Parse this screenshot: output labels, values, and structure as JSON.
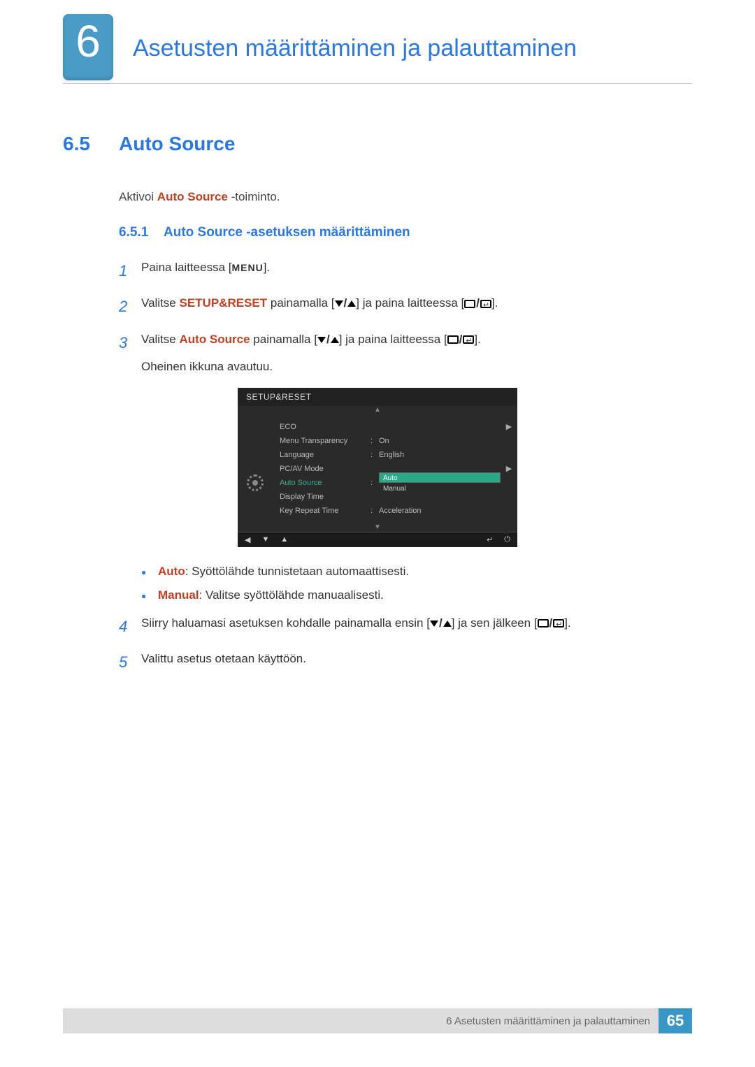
{
  "chapter": {
    "number": "6",
    "title": "Asetusten määrittäminen ja palauttaminen"
  },
  "section": {
    "number": "6.5",
    "title": "Auto Source"
  },
  "intro": {
    "pre": "Aktivoi ",
    "accent": "Auto Source",
    "post": " -toiminto."
  },
  "subsection": {
    "number": "6.5.1",
    "title": "Auto Source -asetuksen määrittäminen"
  },
  "steps": {
    "s1": {
      "num": "1",
      "pre": "Paina laitteessa [",
      "menu": "MENU",
      "post": "]."
    },
    "s2": {
      "num": "2",
      "pre": "Valitse ",
      "accent": "SETUP&RESET",
      "mid": " painamalla [",
      "mid2": "] ja paina laitteessa [",
      "post": "]."
    },
    "s3": {
      "num": "3",
      "pre": "Valitse ",
      "accent": "Auto Source",
      "mid": " painamalla [",
      "mid2": "] ja paina laitteessa [",
      "post": "].",
      "line2": "Oheinen ikkuna avautuu."
    },
    "s4": {
      "num": "4",
      "text_a": "Siirry haluamasi asetuksen kohdalle painamalla ensin [",
      "text_b": "] ja sen jälkeen [",
      "text_c": "]."
    },
    "s5": {
      "num": "5",
      "text": "Valittu asetus otetaan käyttöön."
    }
  },
  "bullets": {
    "b1": {
      "accent": "Auto",
      "text": ": Syöttölähde tunnistetaan automaattisesti."
    },
    "b2": {
      "accent": "Manual",
      "text": ": Valitse syöttölähde manuaalisesti."
    }
  },
  "osd": {
    "title": "SETUP&RESET",
    "rows": {
      "eco": {
        "label": "ECO"
      },
      "mt": {
        "label": "Menu Transparency",
        "val": "On"
      },
      "lang": {
        "label": "Language",
        "val": "English"
      },
      "pcav": {
        "label": "PC/AV Mode"
      },
      "as": {
        "label": "Auto Source"
      },
      "dt": {
        "label": "Display Time"
      },
      "krt": {
        "label": "Key Repeat Time",
        "val": "Acceleration"
      }
    },
    "options": {
      "auto": "Auto",
      "manual": "Manual"
    }
  },
  "footer": {
    "text": "6 Asetusten määrittäminen ja palauttaminen",
    "page": "65"
  }
}
